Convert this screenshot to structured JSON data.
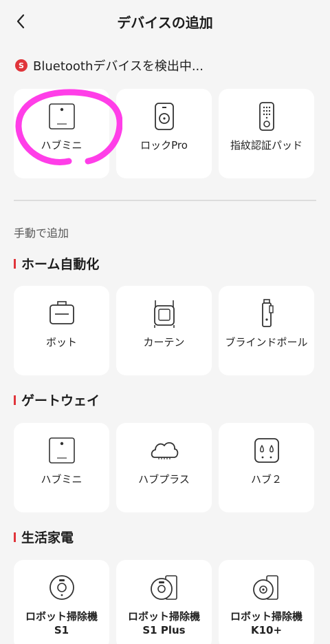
{
  "header": {
    "title": "デバイスの追加"
  },
  "scan": {
    "badge": "S",
    "text": "Bluetoothデバイスを検出中..."
  },
  "found_devices": [
    {
      "label": "ハブミニ",
      "icon": "hub-mini-icon"
    },
    {
      "label": "ロックPro",
      "icon": "lock-pro-icon"
    },
    {
      "label": "指紋認証パッド",
      "icon": "keypad-icon"
    }
  ],
  "manual": {
    "label": "手動で追加"
  },
  "sections": {
    "home_automation": {
      "title": "ホーム自動化",
      "items": [
        {
          "label": "ボット",
          "icon": "bot-icon"
        },
        {
          "label": "カーテン",
          "icon": "curtain-icon"
        },
        {
          "label": "ブラインドポール",
          "icon": "blind-pole-icon"
        }
      ]
    },
    "gateway": {
      "title": "ゲートウェイ",
      "items": [
        {
          "label": "ハブミニ",
          "icon": "hub-mini-icon"
        },
        {
          "label": "ハブプラス",
          "icon": "cloud-hub-icon"
        },
        {
          "label": "ハブ２",
          "icon": "hub2-icon"
        }
      ]
    },
    "appliances": {
      "title": "生活家電",
      "items": [
        {
          "label": "ロボット掃除機\nS1",
          "icon": "robot-vacuum-icon"
        },
        {
          "label": "ロボット掃除機\nS1 Plus",
          "icon": "robot-vacuum-dock-icon"
        },
        {
          "label": "ロボット掃除機\nK10+",
          "icon": "robot-vacuum-k10-icon"
        }
      ]
    }
  },
  "colors": {
    "accent": "#e0353b",
    "highlight": "#ff3ee8",
    "card": "#ffffff",
    "background": "#f5f5f5"
  }
}
